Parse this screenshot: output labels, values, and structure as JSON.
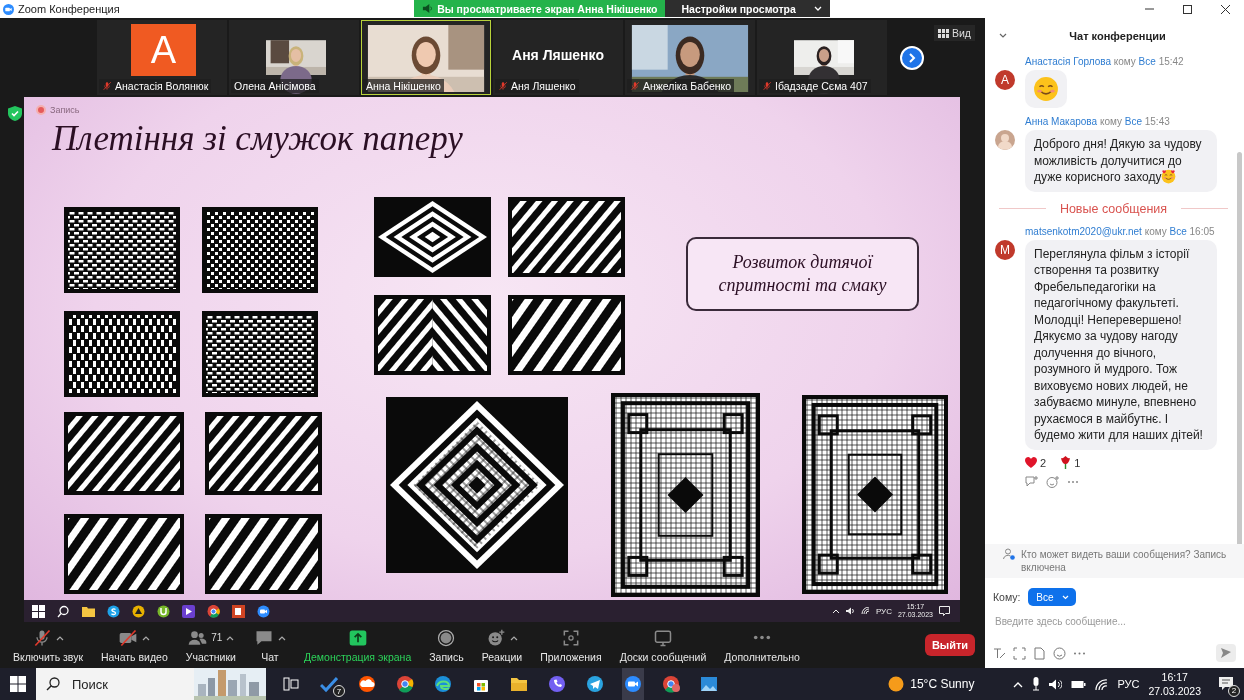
{
  "window": {
    "title": "Zoom Конференция"
  },
  "banner": {
    "text": "Вы просматриваете экран Анна Нікішенко",
    "view_options": "Настройки просмотра"
  },
  "gallery": {
    "view_button": "Вид",
    "tiles": [
      {
        "name": "Анастасія Волянюк",
        "kind": "avatar",
        "letter": "A",
        "muted": true,
        "active": false
      },
      {
        "name": "Олена Анісімова",
        "kind": "video",
        "muted": false,
        "active": false
      },
      {
        "name": "Анна Нікішенко",
        "kind": "video",
        "muted": false,
        "active": true
      },
      {
        "name": "Аня Ляшенко",
        "kind": "name_only",
        "display": "Аня Ляшенко",
        "muted": true,
        "active": false
      },
      {
        "name": "Анжеліка Бабенко",
        "kind": "video",
        "muted": true,
        "active": false
      },
      {
        "name": "Ібадзаде Сєма 407",
        "kind": "video",
        "muted": true,
        "active": false
      }
    ]
  },
  "shared_screen": {
    "recording_label": "Запись",
    "slide": {
      "title": "Плетіння зі смужок паперу",
      "caption": "Розвиток дитячої спритності та смаку"
    },
    "taskbar": {
      "language": "РУС",
      "time": "15:17",
      "date": "27.03.2023"
    }
  },
  "toolbar": {
    "controls": [
      {
        "kind": "mic",
        "label": "Включить звук",
        "off": true,
        "caret": true
      },
      {
        "kind": "video",
        "label": "Начать видео",
        "off": true,
        "caret": true
      },
      {
        "kind": "participants",
        "label": "Участники",
        "count": "71",
        "off": false,
        "caret": true
      },
      {
        "kind": "chat",
        "label": "Чат",
        "off": false,
        "caret": true
      },
      {
        "kind": "share",
        "label": "Демонстрация экрана",
        "off": false,
        "caret": false
      },
      {
        "kind": "record",
        "label": "Запись",
        "off": false,
        "caret": false
      },
      {
        "kind": "reactions",
        "label": "Реакции",
        "off": false,
        "caret": true
      },
      {
        "kind": "apps",
        "label": "Приложения",
        "off": false,
        "caret": false
      },
      {
        "kind": "whiteboard",
        "label": "Доски сообщений",
        "off": false,
        "caret": false
      },
      {
        "kind": "more",
        "label": "Дополнительно",
        "off": false,
        "caret": false
      }
    ],
    "leave": "Выйти"
  },
  "chat": {
    "title": "Чат конференции",
    "messages": [
      {
        "kind": "emoji",
        "sender": "Анастасія Горлова",
        "to": "кому",
        "recipient": "Все",
        "time": "15:42",
        "photo_avatar": false,
        "letter": "A"
      },
      {
        "kind": "text",
        "sender": "Анна Макарова",
        "to": "кому",
        "recipient": "Все",
        "time": "15:43",
        "photo_avatar": true,
        "text": "Доброго дня! Дякую за чудову можливість долучитися до дуже корисного заходу",
        "trailing_emoji": true
      },
      {
        "kind": "divider",
        "text": "Новые сообщения"
      },
      {
        "kind": "text",
        "sender": "matsenkotm2020@ukr.net",
        "to": "кому",
        "recipient": "Все",
        "time": "16:05",
        "photo_avatar": false,
        "letter": "M",
        "text": "Переглянула фільм з історії створення та розвитку Фребельпедагогіки на педагогічному факультеті. Молодці! Неперевершено! Дякуємо за чудову нагоду долучення до вічного, розумного й мудрого. Тож виховуємо нових людей, не забуваємо минуле, впевнено рухаємося в майбутнє. І будемо жити для наших дітей!",
        "trailing_emoji": false,
        "reactions": [
          {
            "kind": "heart",
            "count": "2"
          },
          {
            "kind": "rose",
            "count": "1"
          }
        ]
      }
    ],
    "notice": "Кто может видеть ваши сообщения? Запись включена",
    "to_label": "Кому:",
    "recipient": "Все",
    "placeholder": "Введите здесь сообщение..."
  },
  "taskbar": {
    "search_placeholder": "Поиск",
    "todo_badge": "7",
    "weather": "15°C Sunny",
    "language": "РУС",
    "time": "16:17",
    "date": "27.03.2023",
    "notifications": "2"
  }
}
